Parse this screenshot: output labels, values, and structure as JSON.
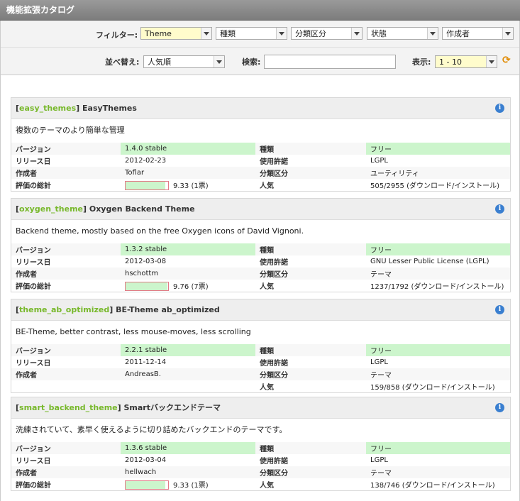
{
  "title": "機能拡張カタログ",
  "filter": {
    "label": "フィルター:",
    "theme": "Theme",
    "type": "種類",
    "category": "分類区分",
    "state": "状態",
    "author": "作成者"
  },
  "sort": {
    "label": "並べ替え:",
    "value": "人気順",
    "search_label": "検索:",
    "search_value": "",
    "show_label": "表示:",
    "show_value": "1 - 10"
  },
  "labels": {
    "version": "バージョン",
    "release": "リリース日",
    "author": "作成者",
    "rating": "評価の総計",
    "type": "種類",
    "license": "使用許諾",
    "category": "分類区分",
    "popularity": "人気"
  },
  "extensions": [
    {
      "key": "easy_themes",
      "name": "EasyThemes",
      "desc": "複数のテーマのより簡単な管理",
      "version": "1.4.0 stable",
      "release": "2012-02-23",
      "author": "Toflar",
      "rating": "9.33 (1票)",
      "rating_fraction": 0.93,
      "type": "フリー",
      "license": "LGPL",
      "category": "ユーティリティ",
      "popularity": "505/2955 (ダウンロード/インストール)"
    },
    {
      "key": "oxygen_theme",
      "name": "Oxygen Backend Theme",
      "desc": "Backend theme, mostly based on the free Oxygen icons of David Vignoni.",
      "version": "1.3.2 stable",
      "release": "2012-03-08",
      "author": "hschottm",
      "rating": "9.76 (7票)",
      "rating_fraction": 0.98,
      "type": "フリー",
      "license": "GNU Lesser Public License (LGPL)",
      "category": "テーマ",
      "popularity": "1237/1792 (ダウンロード/インストール)"
    },
    {
      "key": "theme_ab_optimized",
      "name": "BE-Theme ab_optimized",
      "desc": "BE-Theme, better contrast, less mouse-moves, less scrolling",
      "version": "2.2.1 stable",
      "release": "2011-12-14",
      "author": "AndreasB.",
      "rating": "",
      "type": "フリー",
      "license": "LGPL",
      "category": "テーマ",
      "popularity": "159/858 (ダウンロード/インストール)"
    },
    {
      "key": "smart_backend_theme",
      "name": "Smartバックエンドテーマ",
      "desc": "洗練されていて、素早く使えるように切り詰めたバックエンドのテーマです。",
      "version": "1.3.6 stable",
      "release": "2012-03-04",
      "author": "hellwach",
      "rating": "9.33 (1票)",
      "rating_fraction": 0.93,
      "type": "フリー",
      "license": "LGPL",
      "category": "テーマ",
      "popularity": "138/746 (ダウンロード/インストール)"
    }
  ]
}
